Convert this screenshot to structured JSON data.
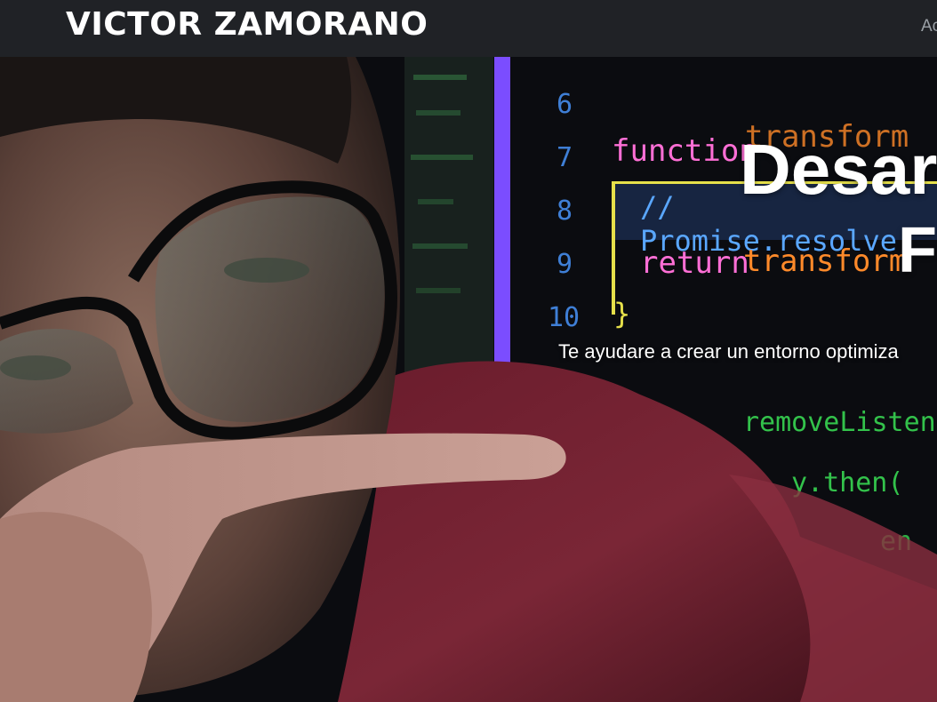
{
  "navbar": {
    "brand": "VICTOR ZAMORANO",
    "link_partial": "Ac"
  },
  "hero": {
    "title_line1": "Desar",
    "title_line2": "F",
    "subtitle": "Te ayudare a crear un entorno optimiza",
    "code": {
      "line_numbers": [
        "6",
        "7",
        "8",
        "9",
        "10"
      ],
      "keyword_function": "function",
      "fn_name": "transform",
      "comment": "// Promise.resolve",
      "keyword_return": "return",
      "return_value": "transform",
      "brace": "}",
      "lower_line_1": "removeListener",
      "lower_line_2": "y.then(",
      "lower_line_3": "en"
    }
  },
  "colors": {
    "navbar_bg": "#202226",
    "brand_text": "#ffffff",
    "nav_link": "#9aa0a6",
    "code_keyword": "#ff6fd6",
    "code_fn": "#ff8a2a",
    "code_comment": "#5aa7ff",
    "code_linenum": "#3f7fd6",
    "code_green": "#3df05a",
    "editor_bar": "#7b4dff"
  }
}
